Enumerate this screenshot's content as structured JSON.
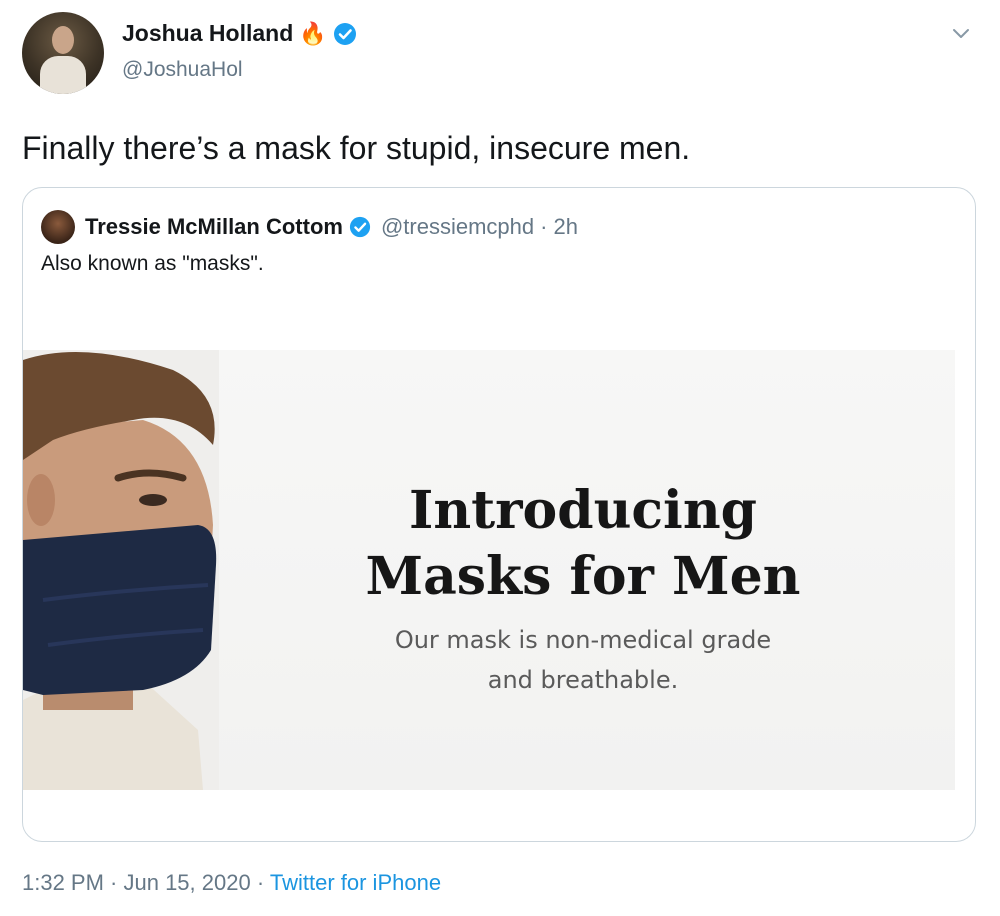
{
  "tweet": {
    "display_name": "Joshua Holland",
    "name_emoji_icon": "fire-icon",
    "handle": "@JoshuaHol",
    "text": "Finally there’s a mask for stupid, insecure men.",
    "timestamp": "1:32 PM · Jun 15, 2020",
    "footer_separator": "·",
    "source": "Twitter for iPhone"
  },
  "quoted_tweet": {
    "display_name": "Tressie McMillan Cottom",
    "handle": "@tressiemcphd",
    "separator": "·",
    "time": "2h",
    "text": "Also known as \"masks\".",
    "media": {
      "headline_line1": "Introducing",
      "headline_line2": "Masks for Men",
      "subtext_line1": "Our mask is non-medical grade",
      "subtext_line2": "and breathable."
    }
  },
  "colors": {
    "verified": "#1da1f2",
    "link": "#1b95e0",
    "secondary_text": "#657786",
    "mask_navy": "#1e2a44"
  }
}
